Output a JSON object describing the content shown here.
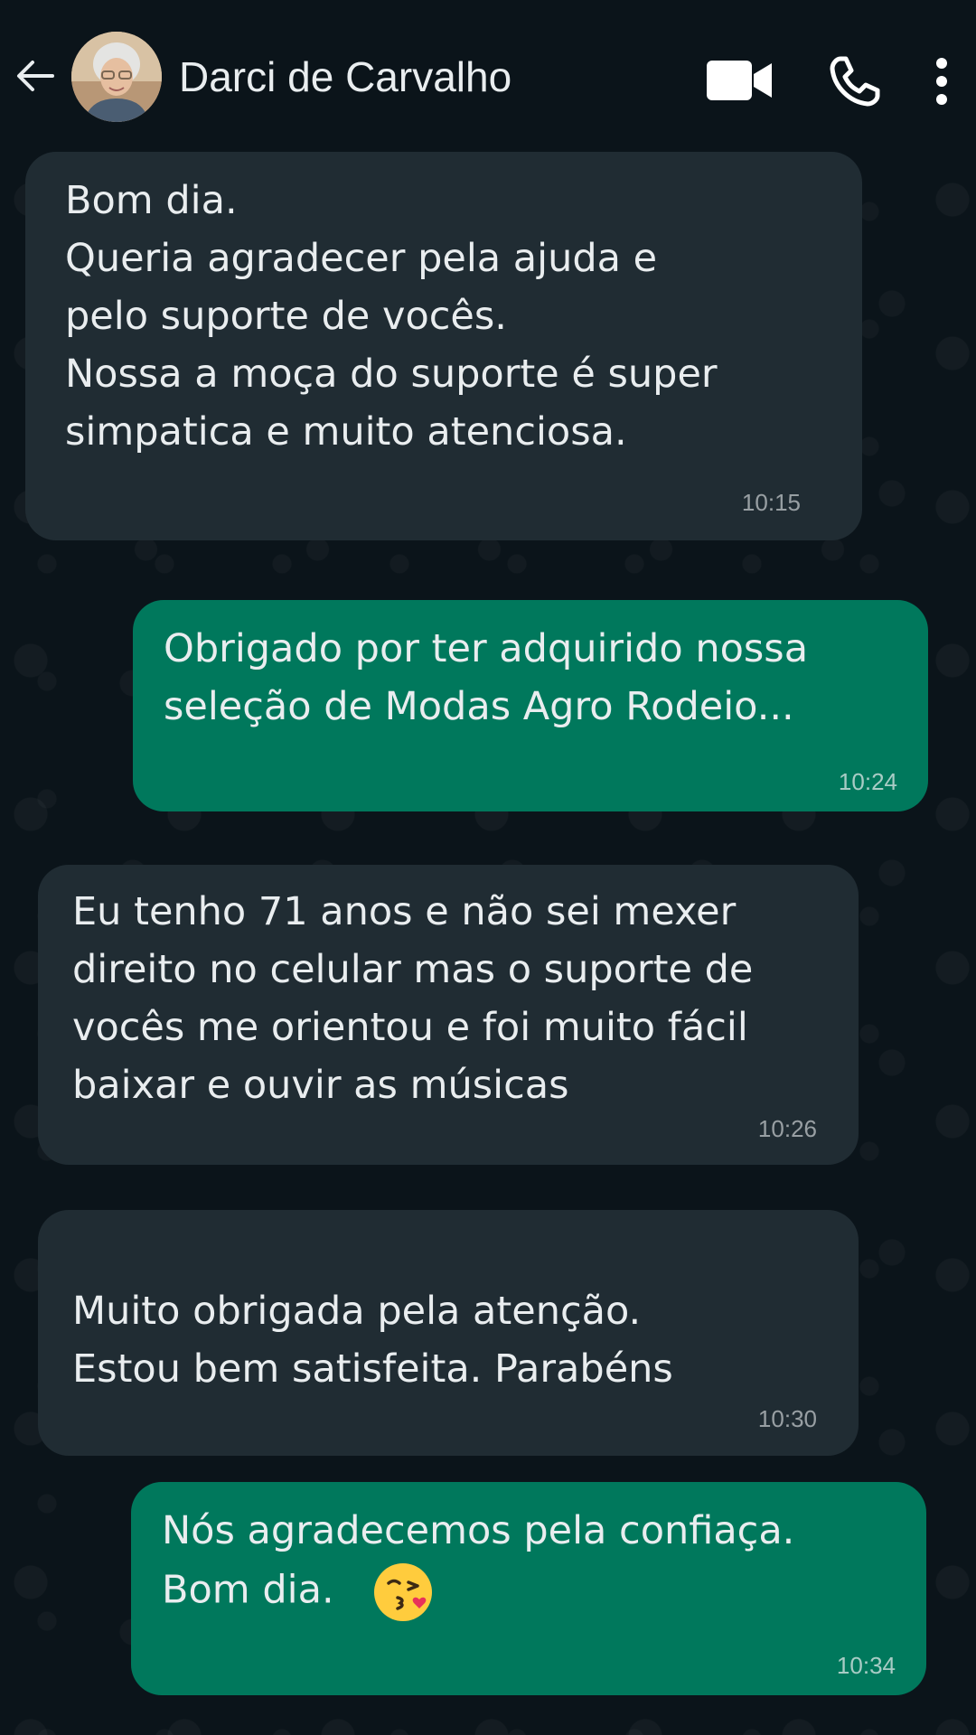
{
  "header": {
    "contact_name": "Darci de Carvalho",
    "icons": {
      "back": "arrow-left-icon",
      "video": "video-camera-icon",
      "call": "phone-icon",
      "menu": "more-vertical-icon"
    }
  },
  "colors": {
    "background": "#0b141a",
    "incoming_bubble": "#202c33",
    "outgoing_bubble": "#00785c",
    "text": "#e9edef"
  },
  "messages": [
    {
      "direction": "incoming",
      "text": "Bom dia.\nQueria agradecer pela ajuda e\npelo suporte de vocês.\nNossa a moça do suporte é super\nsimpatica e muito atenciosa.",
      "time": "10:15"
    },
    {
      "direction": "outgoing",
      "text": "Obrigado por ter adquirido nossa\nseleção de Modas Agro Rodeio...",
      "time": "10:24"
    },
    {
      "direction": "incoming",
      "text": "Eu tenho 71 anos e não sei mexer\ndireito no celular mas o suporte de\nvocês me orientou e foi muito fácil\nbaixar e ouvir as músicas",
      "time": "10:26"
    },
    {
      "direction": "incoming",
      "text": "Muito obrigada pela atenção.\nEstou bem satisfeita. Parabéns",
      "time": "10:30"
    },
    {
      "direction": "outgoing",
      "text": "Nós agradecemos pela confiaça.\nBom dia.",
      "emoji": "face-blowing-kiss-emoji",
      "time": "10:34"
    }
  ]
}
